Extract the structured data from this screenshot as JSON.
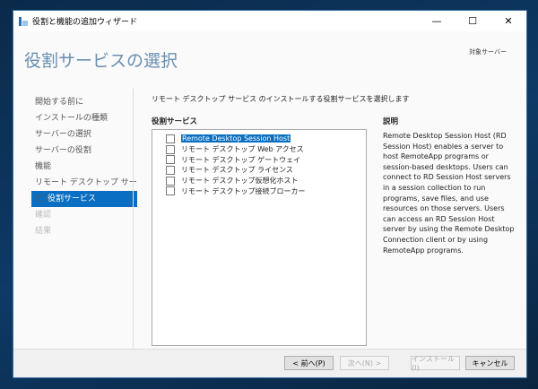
{
  "window": {
    "title": "役割と機能の追加ウィザード"
  },
  "page": {
    "title": "役割サービスの選択",
    "target_server": "対象サーバー",
    "intro": "リモート デスクトップ サービス のインストールする役割サービスを選択します",
    "services_label": "役割サービス",
    "description_label": "説明",
    "description": "Remote Desktop Session Host (RD Session Host) enables a server to host RemoteApp programs or session-based desktops. Users can connect to RD Session Host servers in a session collection to run programs, save files, and use resources on those servers. Users can access an RD Session Host server by using the Remote Desktop Connection client or by using RemoteApp programs."
  },
  "nav": [
    "開始する前に",
    "インストールの種類",
    "サーバーの選択",
    "サーバーの役割",
    "機能",
    "リモート デスクトップ サービス",
    "役割サービス",
    "確認",
    "結果"
  ],
  "services": [
    "Remote Desktop Session Host",
    "リモート デスクトップ Web アクセス",
    "リモート デスクトップ ゲートウェイ",
    "リモート デスクトップ ライセンス",
    "リモート デスクトップ仮想化ホスト",
    "リモート デスクトップ接続ブローカー"
  ],
  "buttons": {
    "prev": "< 前へ(P)",
    "next": "次へ(N) >",
    "install": "インストール(I)",
    "cancel": "キャンセル"
  },
  "controls": {
    "minimize": "—",
    "maximize": "☐",
    "close": "✕"
  }
}
